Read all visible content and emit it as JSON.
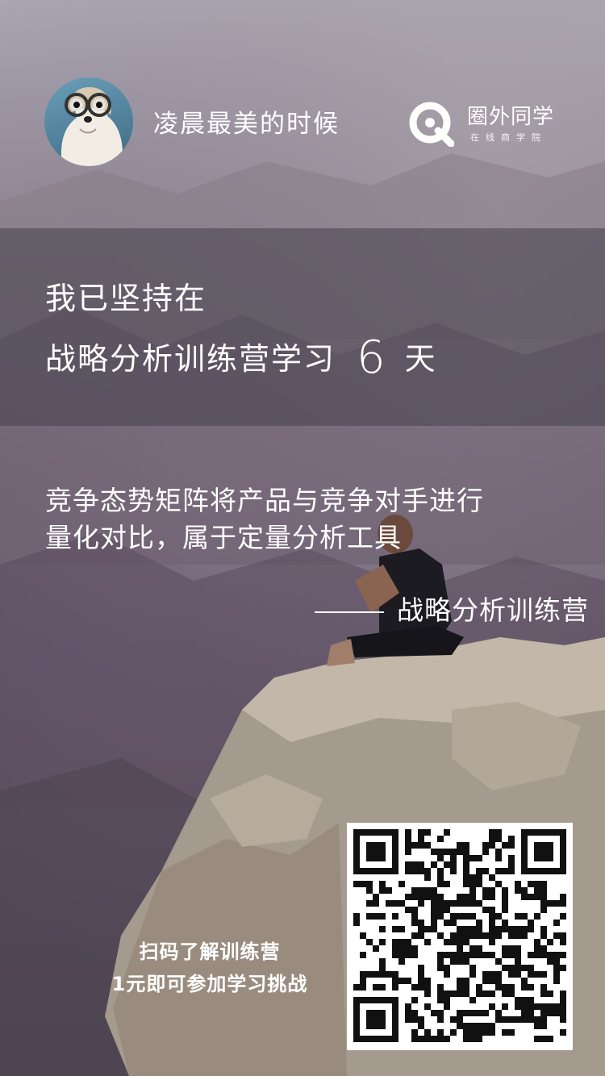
{
  "user": {
    "name": "凌晨最美的时候"
  },
  "brand": {
    "name": "圈外同学",
    "subtitle": "在线商学院"
  },
  "headline": {
    "line1": "我已坚持在",
    "course_prefix": "战略分析训练营学习",
    "days": "6",
    "unit": "天"
  },
  "quote": {
    "lines": [
      "竞争态势矩阵将产品与竞争对手进行",
      "量化对比，属于定量分析工具"
    ],
    "source": "战略分析训练营"
  },
  "cta": {
    "line1": "扫码了解训练营",
    "line2": "1元即可参加学习挑战"
  }
}
